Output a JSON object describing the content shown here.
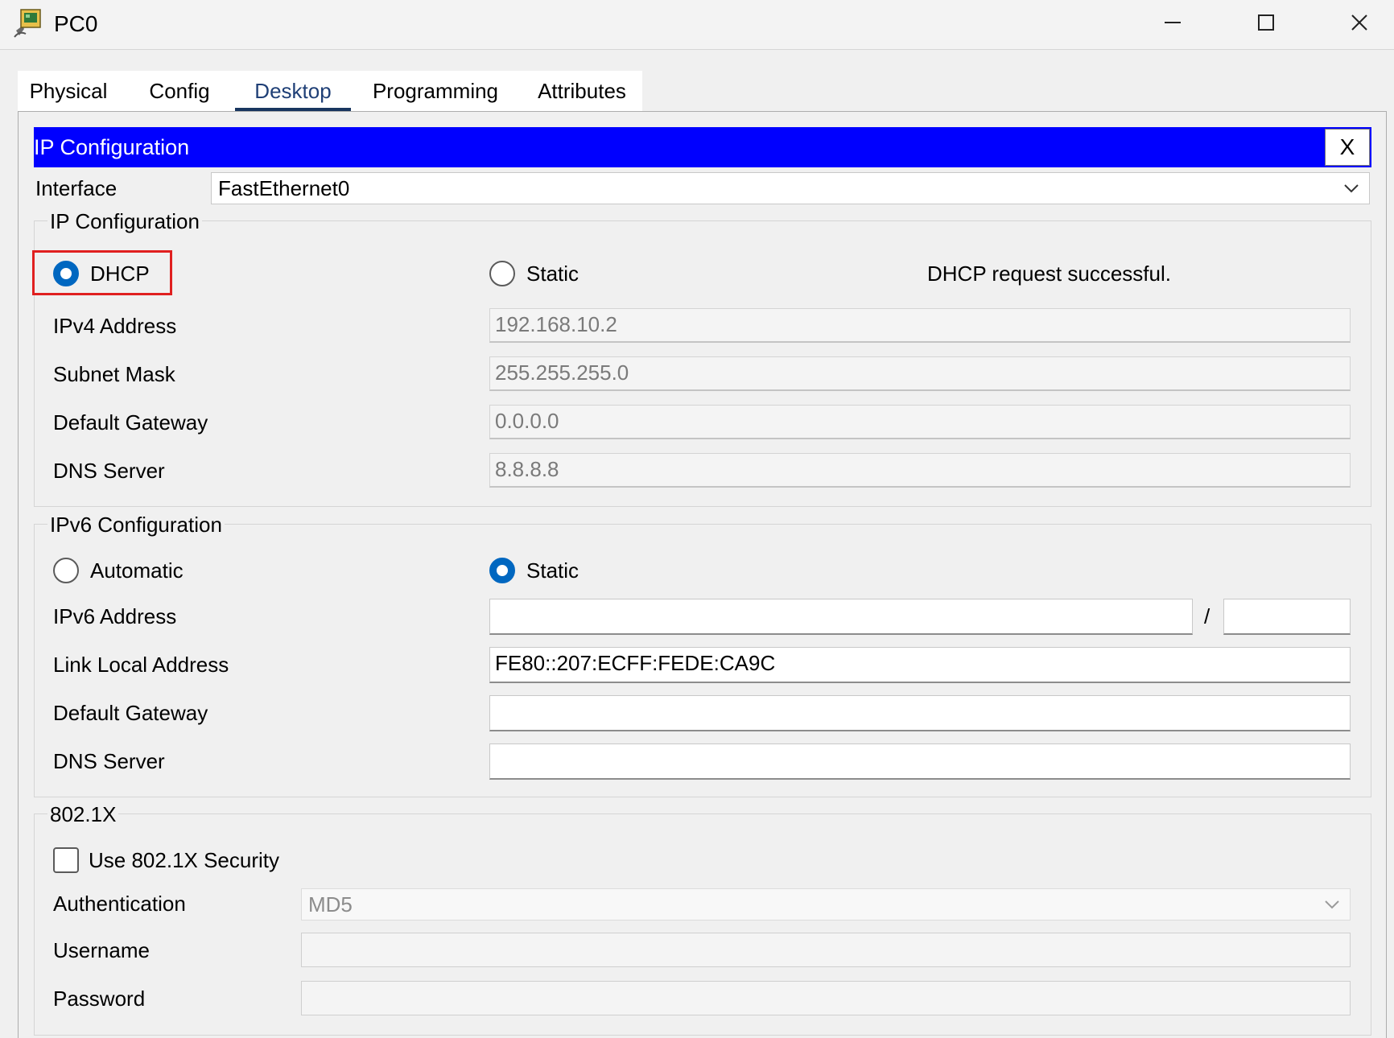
{
  "window": {
    "title": "PC0",
    "icon": "pc-device-icon",
    "controls": [
      "minimize-icon",
      "maximize-icon",
      "close-icon"
    ]
  },
  "tabs": [
    {
      "label": "Physical",
      "active": false
    },
    {
      "label": "Config",
      "active": false
    },
    {
      "label": "Desktop",
      "active": true
    },
    {
      "label": "Programming",
      "active": false
    },
    {
      "label": "Attributes",
      "active": false
    }
  ],
  "ip_panel": {
    "title": "IP Configuration",
    "close_label": "X",
    "interface_label": "Interface",
    "interface_value": "FastEthernet0"
  },
  "ipv4": {
    "legend": "IP Configuration",
    "dhcp_label": "DHCP",
    "dhcp_selected": true,
    "static_label": "Static",
    "static_selected": false,
    "status": "DHCP request successful.",
    "fields": [
      {
        "label": "IPv4 Address",
        "value": "192.168.10.2"
      },
      {
        "label": "Subnet Mask",
        "value": "255.255.255.0"
      },
      {
        "label": "Default Gateway",
        "value": "0.0.0.0"
      },
      {
        "label": "DNS Server",
        "value": "8.8.8.8"
      }
    ]
  },
  "ipv6": {
    "legend": "IPv6 Configuration",
    "automatic_label": "Automatic",
    "automatic_selected": false,
    "static_label": "Static",
    "static_selected": true,
    "address_label": "IPv6 Address",
    "address_value": "",
    "prefix_separator": "/",
    "prefix_value": "",
    "link_local_label": "Link Local Address",
    "link_local_value": "FE80::207:ECFF:FEDE:CA9C",
    "gateway_label": "Default Gateway",
    "gateway_value": "",
    "dns_label": "DNS Server",
    "dns_value": ""
  },
  "dot1x": {
    "legend": "802.1X",
    "use_security_label": "Use 802.1X Security",
    "use_security_checked": false,
    "auth_label": "Authentication",
    "auth_value": "MD5",
    "username_label": "Username",
    "username_value": "",
    "password_label": "Password",
    "password_value": ""
  },
  "colors": {
    "title_bar_blue": "#0000ff",
    "radio_selected": "#0067c0",
    "highlight_box": "#e02020",
    "active_tab_underline": "#18355f"
  }
}
